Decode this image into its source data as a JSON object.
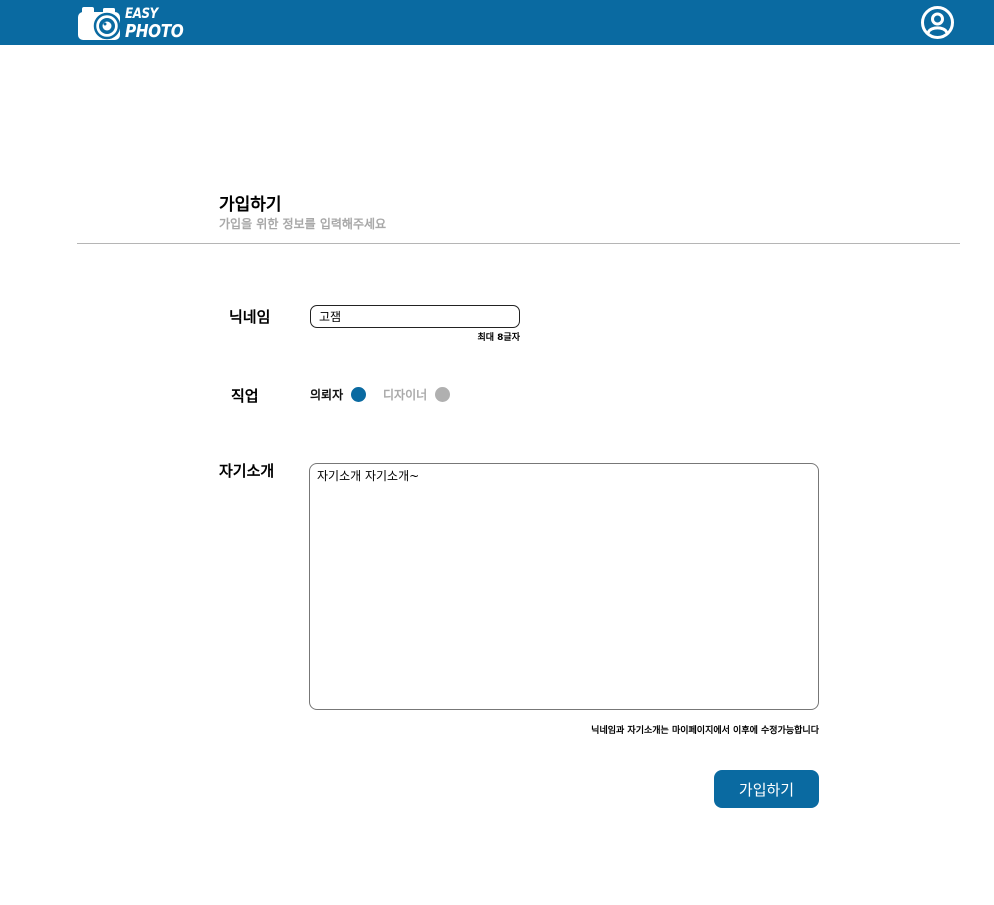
{
  "header": {
    "logo_line1": "EASY",
    "logo_line2": "PHOTO",
    "logo_icon": "camera-icon",
    "profile_icon": "user-circle-icon",
    "brand_color": "#0a6aa1"
  },
  "page": {
    "title": "가입하기",
    "subtitle": "가입을 위한 정보를 입력해주세요"
  },
  "form": {
    "nickname": {
      "label": "닉네임",
      "value": "고잼",
      "hint": "최대 8글자"
    },
    "job": {
      "label": "직업",
      "options": [
        {
          "label": "의뢰자",
          "selected": true
        },
        {
          "label": "디자이너",
          "selected": false
        }
      ]
    },
    "intro": {
      "label": "자기소개",
      "value": "자기소개 자기소개~",
      "hint": "닉네임과 자기소개는 마이페이지에서 이후에 수정가능합니다"
    },
    "submit_label": "가입하기"
  }
}
